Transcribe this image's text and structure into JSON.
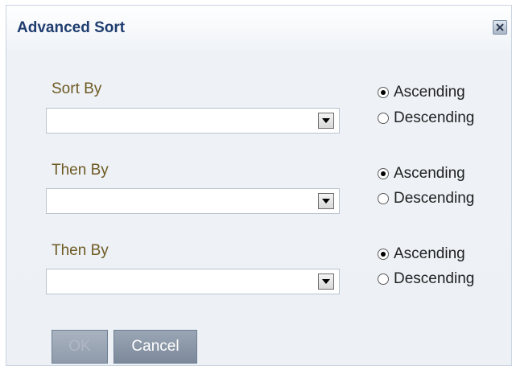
{
  "dialog": {
    "title": "Advanced Sort"
  },
  "groups": [
    {
      "label": "Sort By",
      "value": "",
      "options": [
        {
          "label": "Ascending",
          "checked": true
        },
        {
          "label": "Descending",
          "checked": false
        }
      ]
    },
    {
      "label": "Then By",
      "value": "",
      "options": [
        {
          "label": "Ascending",
          "checked": true
        },
        {
          "label": "Descending",
          "checked": false
        }
      ]
    },
    {
      "label": "Then By",
      "value": "",
      "options": [
        {
          "label": "Ascending",
          "checked": true
        },
        {
          "label": "Descending",
          "checked": false
        }
      ]
    }
  ],
  "buttons": {
    "ok": "OK",
    "cancel": "Cancel",
    "ok_disabled": true
  },
  "icons": {
    "close": "close-icon",
    "dropdown": "chevron-down-icon",
    "radio_selected": "radio-selected-icon",
    "radio_unselected": "radio-unselected-icon"
  },
  "colors": {
    "title": "#1f3d6f",
    "label": "#6e5a22",
    "button": "#8a96a6"
  }
}
